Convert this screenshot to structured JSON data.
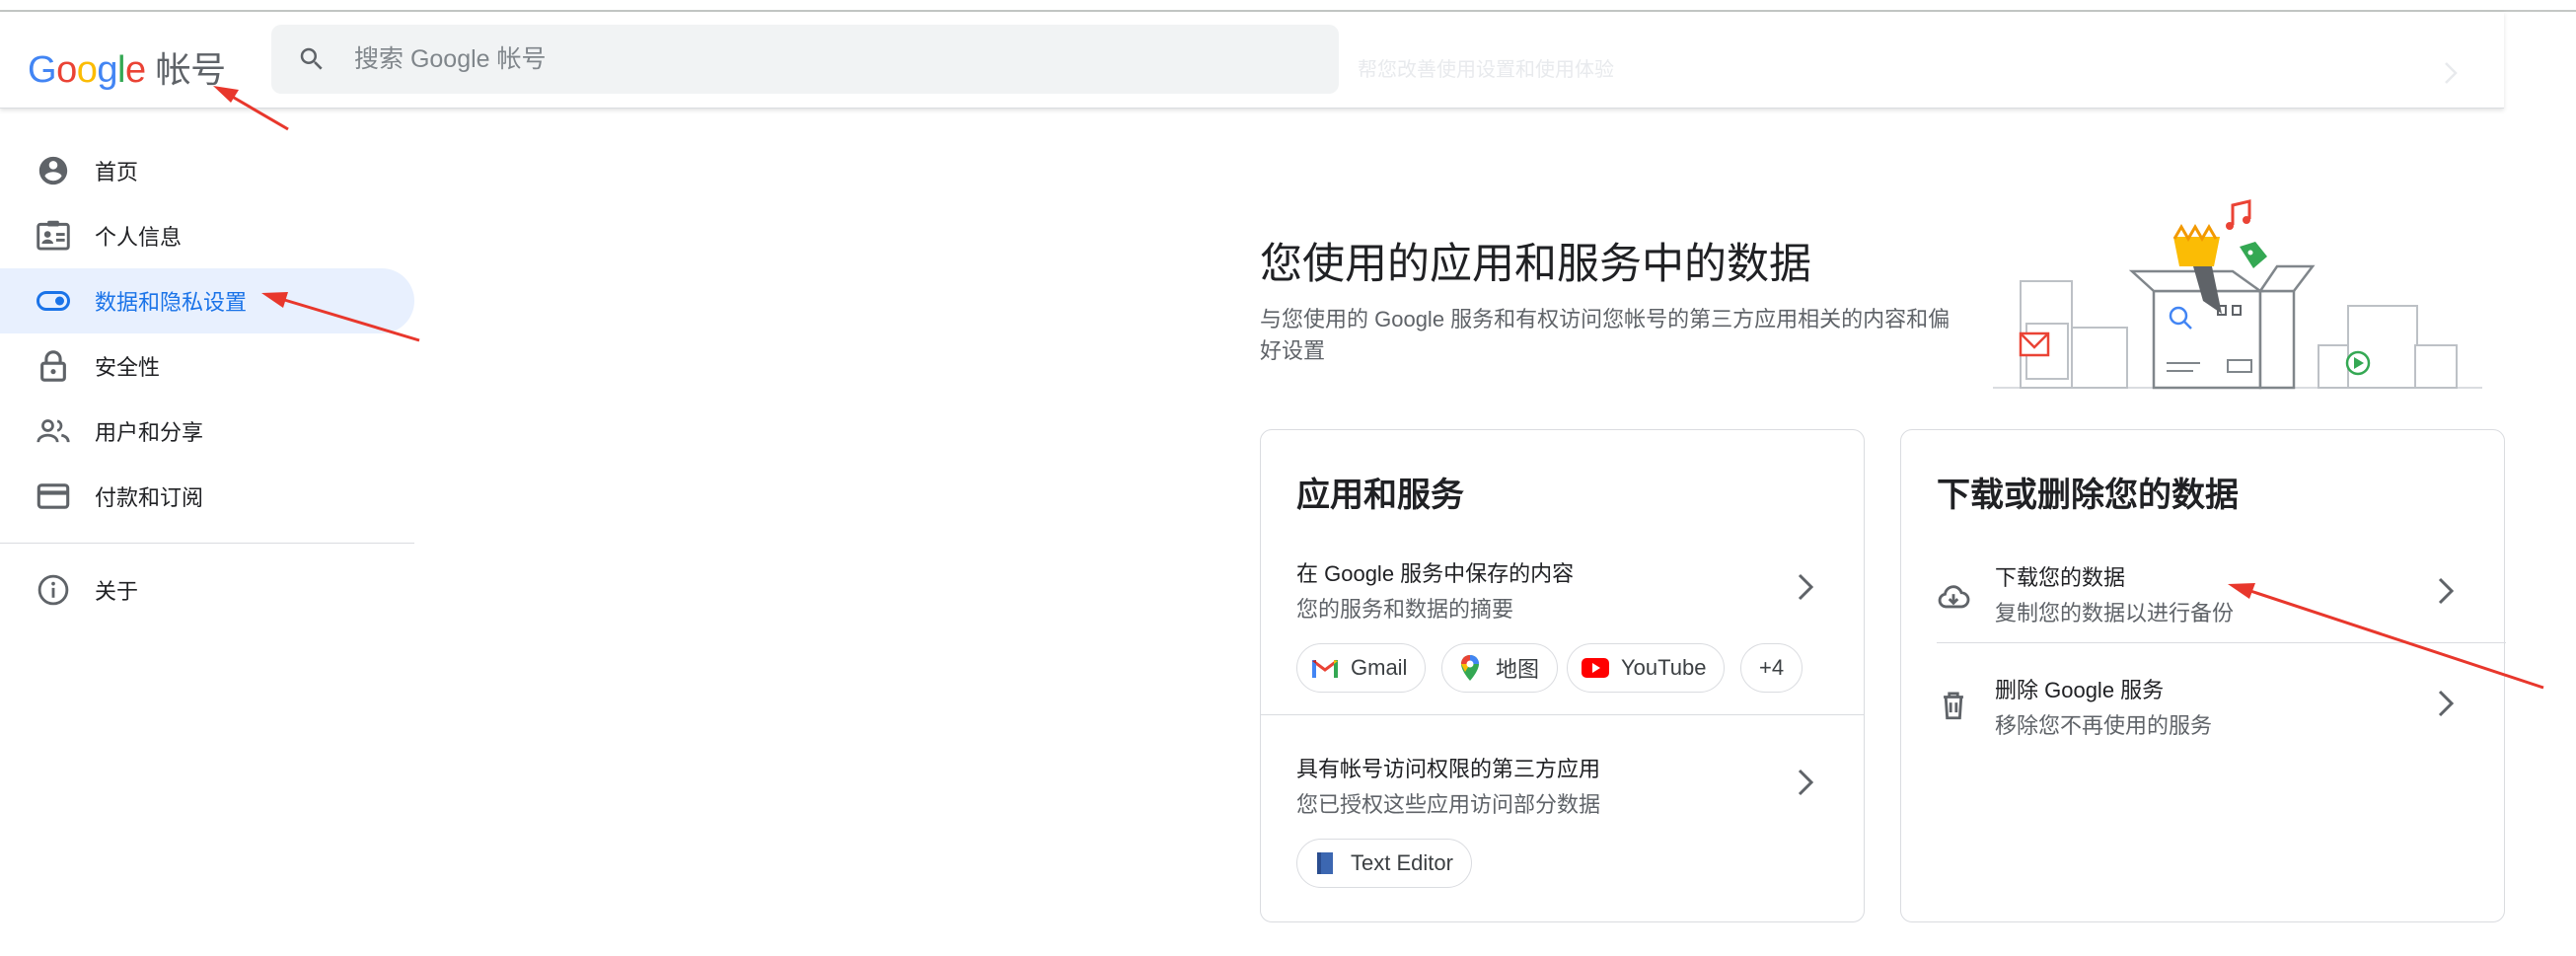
{
  "header": {
    "logo_text": "Google",
    "product_name": "帐号",
    "search_placeholder": "搜索 Google 帐号",
    "ghost_text": "帮您改善使用设置和使用体验"
  },
  "sidebar": {
    "items": [
      {
        "label": "首页",
        "icon": "account-circle-icon"
      },
      {
        "label": "个人信息",
        "icon": "id-card-icon"
      },
      {
        "label": "数据和隐私设置",
        "icon": "toggle-icon",
        "active": true
      },
      {
        "label": "安全性",
        "icon": "lock-icon"
      },
      {
        "label": "用户和分享",
        "icon": "people-icon"
      },
      {
        "label": "付款和订阅",
        "icon": "credit-card-icon"
      }
    ],
    "about": {
      "label": "关于",
      "icon": "info-icon"
    }
  },
  "intro": {
    "title": "您使用的应用和服务中的数据",
    "description": "与您使用的 Google 服务和有权访问您帐号的第三方应用相关的内容和偏好设置"
  },
  "apps_card": {
    "title": "应用和服务",
    "saved_content": {
      "title": "在 Google 服务中保存的内容",
      "subtitle": "您的服务和数据的摘要"
    },
    "chips": [
      {
        "label": "Gmail",
        "icon": "gmail-icon"
      },
      {
        "label": "地图",
        "icon": "maps-pin-icon"
      },
      {
        "label": "YouTube",
        "icon": "youtube-icon"
      },
      {
        "label": "+4"
      }
    ],
    "third_party": {
      "title": "具有帐号访问权限的第三方应用",
      "subtitle": "您已授权这些应用访问部分数据"
    },
    "third_party_chips": [
      {
        "label": "Text Editor",
        "icon": "text-editor-icon"
      }
    ]
  },
  "data_card": {
    "title": "下载或删除您的数据",
    "download": {
      "title": "下载您的数据",
      "subtitle": "复制您的数据以进行备份",
      "icon": "cloud-download-icon"
    },
    "delete": {
      "title": "删除 Google 服务",
      "subtitle": "移除您不再使用的服务",
      "icon": "trash-icon"
    }
  },
  "colors": {
    "accent": "#1a73e8",
    "active_bg": "#e8f0fe",
    "annotation": "#e8372c"
  }
}
